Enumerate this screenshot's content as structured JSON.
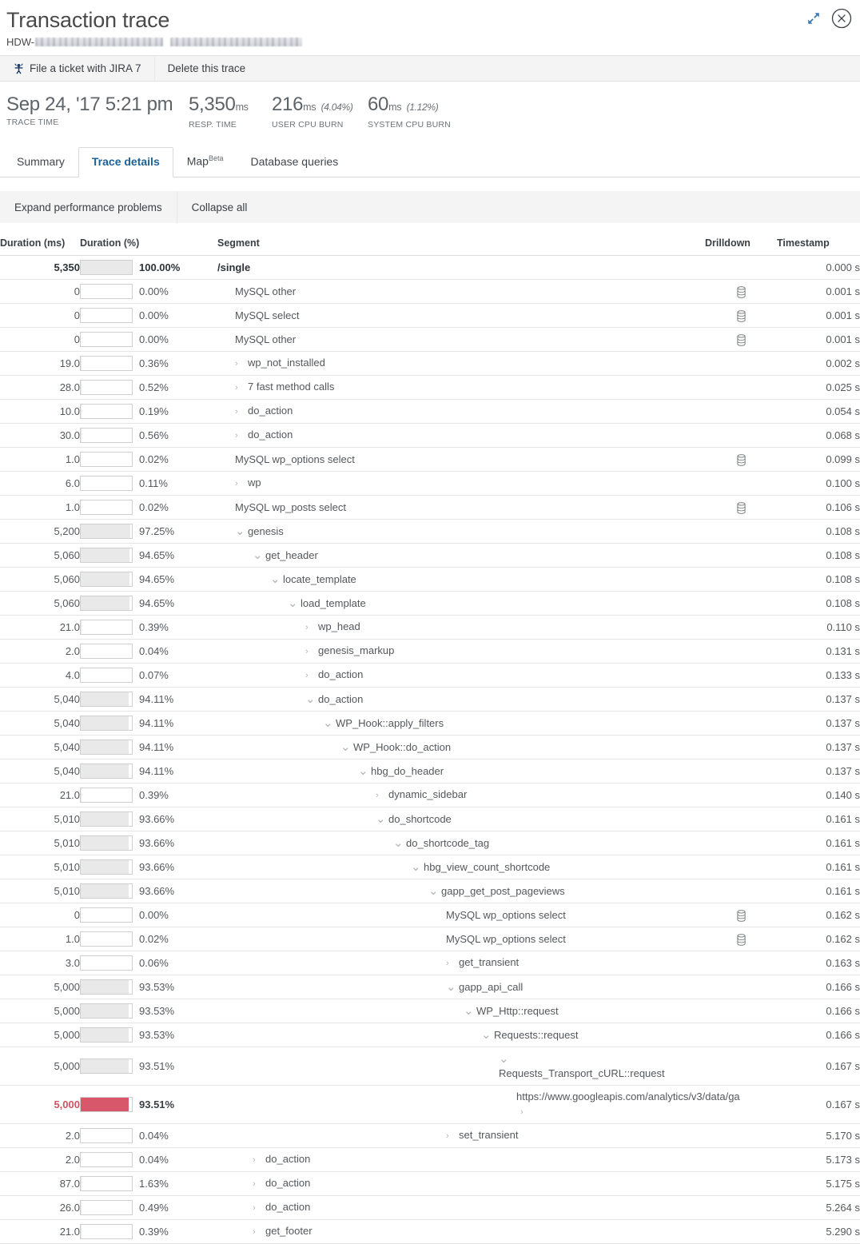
{
  "header": {
    "title": "Transaction trace",
    "subtitle_prefix": "HDW-",
    "expand_icon": "expand-icon",
    "close_icon": "close-circle-icon"
  },
  "actions": {
    "jira_icon": "jira-icon",
    "file_ticket": "File a ticket with JIRA 7",
    "delete_trace": "Delete this trace"
  },
  "metrics": [
    {
      "value": "Sep 24, '17 5:21 pm",
      "unit": "",
      "pct": "",
      "label": "TRACE TIME"
    },
    {
      "value": "5,350",
      "unit": "ms",
      "pct": "",
      "label": "RESP. TIME"
    },
    {
      "value": "216",
      "unit": "ms",
      "pct": "(4.04%)",
      "label": "USER CPU BURN"
    },
    {
      "value": "60",
      "unit": "ms",
      "pct": "(1.12%)",
      "label": "SYSTEM CPU BURN"
    }
  ],
  "tabs": [
    {
      "label": "Summary",
      "sup": "",
      "active": false
    },
    {
      "label": "Trace details",
      "sup": "",
      "active": true
    },
    {
      "label": "Map",
      "sup": "Beta",
      "active": false
    },
    {
      "label": "Database queries",
      "sup": "",
      "active": false
    }
  ],
  "subbar": [
    {
      "label": "Expand performance problems"
    },
    {
      "label": "Collapse all"
    }
  ],
  "table": {
    "columns": {
      "duration_ms": "Duration (ms)",
      "duration_pct": "Duration (%)",
      "segment": "Segment",
      "drilldown": "Drilldown",
      "timestamp": "Timestamp"
    },
    "rows": [
      {
        "duration": "5,350",
        "pct": "100.00%",
        "bar": 100,
        "level": 0,
        "chevron": "none",
        "segment": "/single",
        "drilldown": false,
        "timestamp": "0.000 s",
        "root": true
      },
      {
        "duration": "0",
        "pct": "0.00%",
        "bar": 0,
        "level": 1,
        "chevron": "none",
        "segment": "MySQL other",
        "drilldown": true,
        "timestamp": "0.001 s"
      },
      {
        "duration": "0",
        "pct": "0.00%",
        "bar": 0,
        "level": 1,
        "chevron": "none",
        "segment": "MySQL select",
        "drilldown": true,
        "timestamp": "0.001 s"
      },
      {
        "duration": "0",
        "pct": "0.00%",
        "bar": 0,
        "level": 1,
        "chevron": "none",
        "segment": "MySQL other",
        "drilldown": true,
        "timestamp": "0.001 s"
      },
      {
        "duration": "19.0",
        "pct": "0.36%",
        "bar": 0.36,
        "level": 1,
        "chevron": "right",
        "segment": "wp_not_installed",
        "drilldown": false,
        "timestamp": "0.002 s"
      },
      {
        "duration": "28.0",
        "pct": "0.52%",
        "bar": 0.52,
        "level": 1,
        "chevron": "right",
        "segment": "7 fast method calls",
        "drilldown": false,
        "timestamp": "0.025 s"
      },
      {
        "duration": "10.0",
        "pct": "0.19%",
        "bar": 0.19,
        "level": 1,
        "chevron": "right",
        "segment": "do_action",
        "drilldown": false,
        "timestamp": "0.054 s"
      },
      {
        "duration": "30.0",
        "pct": "0.56%",
        "bar": 0.56,
        "level": 1,
        "chevron": "right",
        "segment": "do_action",
        "drilldown": false,
        "timestamp": "0.068 s"
      },
      {
        "duration": "1.0",
        "pct": "0.02%",
        "bar": 0.02,
        "level": 1,
        "chevron": "none",
        "segment": "MySQL wp_options select",
        "drilldown": true,
        "timestamp": "0.099 s"
      },
      {
        "duration": "6.0",
        "pct": "0.11%",
        "bar": 0.11,
        "level": 1,
        "chevron": "right",
        "segment": "wp",
        "drilldown": false,
        "timestamp": "0.100 s"
      },
      {
        "duration": "1.0",
        "pct": "0.02%",
        "bar": 0.02,
        "level": 1,
        "chevron": "none",
        "segment": "MySQL wp_posts select",
        "drilldown": true,
        "timestamp": "0.106 s"
      },
      {
        "duration": "5,200",
        "pct": "97.25%",
        "bar": 97.25,
        "level": 1,
        "chevron": "down",
        "segment": "genesis",
        "drilldown": false,
        "timestamp": "0.108 s"
      },
      {
        "duration": "5,060",
        "pct": "94.65%",
        "bar": 94.65,
        "level": 2,
        "chevron": "down",
        "segment": "get_header",
        "drilldown": false,
        "timestamp": "0.108 s"
      },
      {
        "duration": "5,060",
        "pct": "94.65%",
        "bar": 94.65,
        "level": 3,
        "chevron": "down",
        "segment": "locate_template",
        "drilldown": false,
        "timestamp": "0.108 s"
      },
      {
        "duration": "5,060",
        "pct": "94.65%",
        "bar": 94.65,
        "level": 4,
        "chevron": "down",
        "segment": "load_template",
        "drilldown": false,
        "timestamp": "0.108 s"
      },
      {
        "duration": "21.0",
        "pct": "0.39%",
        "bar": 0.39,
        "level": 5,
        "chevron": "right",
        "segment": "wp_head",
        "drilldown": false,
        "timestamp": "0.110 s"
      },
      {
        "duration": "2.0",
        "pct": "0.04%",
        "bar": 0.04,
        "level": 5,
        "chevron": "right",
        "segment": "genesis_markup",
        "drilldown": false,
        "timestamp": "0.131 s"
      },
      {
        "duration": "4.0",
        "pct": "0.07%",
        "bar": 0.07,
        "level": 5,
        "chevron": "right",
        "segment": "do_action",
        "drilldown": false,
        "timestamp": "0.133 s"
      },
      {
        "duration": "5,040",
        "pct": "94.11%",
        "bar": 94.11,
        "level": 5,
        "chevron": "down",
        "segment": "do_action",
        "drilldown": false,
        "timestamp": "0.137 s"
      },
      {
        "duration": "5,040",
        "pct": "94.11%",
        "bar": 94.11,
        "level": 6,
        "chevron": "down",
        "segment": "WP_Hook::apply_filters",
        "drilldown": false,
        "timestamp": "0.137 s"
      },
      {
        "duration": "5,040",
        "pct": "94.11%",
        "bar": 94.11,
        "level": 7,
        "chevron": "down",
        "segment": "WP_Hook::do_action",
        "drilldown": false,
        "timestamp": "0.137 s"
      },
      {
        "duration": "5,040",
        "pct": "94.11%",
        "bar": 94.11,
        "level": 8,
        "chevron": "down",
        "segment": "hbg_do_header",
        "drilldown": false,
        "timestamp": "0.137 s"
      },
      {
        "duration": "21.0",
        "pct": "0.39%",
        "bar": 0.39,
        "level": 9,
        "chevron": "right",
        "segment": "dynamic_sidebar",
        "drilldown": false,
        "timestamp": "0.140 s"
      },
      {
        "duration": "5,010",
        "pct": "93.66%",
        "bar": 93.66,
        "level": 9,
        "chevron": "down",
        "segment": "do_shortcode",
        "drilldown": false,
        "timestamp": "0.161 s"
      },
      {
        "duration": "5,010",
        "pct": "93.66%",
        "bar": 93.66,
        "level": 10,
        "chevron": "down",
        "segment": "do_shortcode_tag",
        "drilldown": false,
        "timestamp": "0.161 s"
      },
      {
        "duration": "5,010",
        "pct": "93.66%",
        "bar": 93.66,
        "level": 11,
        "chevron": "down",
        "segment": "hbg_view_count_shortcode",
        "drilldown": false,
        "timestamp": "0.161 s"
      },
      {
        "duration": "5,010",
        "pct": "93.66%",
        "bar": 93.66,
        "level": 12,
        "chevron": "down",
        "segment": "gapp_get_post_pageviews",
        "drilldown": false,
        "timestamp": "0.161 s"
      },
      {
        "duration": "0",
        "pct": "0.00%",
        "bar": 0,
        "level": 13,
        "chevron": "none",
        "segment": "MySQL wp_options select",
        "drilldown": true,
        "timestamp": "0.162 s"
      },
      {
        "duration": "1.0",
        "pct": "0.02%",
        "bar": 0.02,
        "level": 13,
        "chevron": "none",
        "segment": "MySQL wp_options select",
        "drilldown": true,
        "timestamp": "0.162 s"
      },
      {
        "duration": "3.0",
        "pct": "0.06%",
        "bar": 0.06,
        "level": 13,
        "chevron": "right",
        "segment": "get_transient",
        "drilldown": false,
        "timestamp": "0.163 s"
      },
      {
        "duration": "5,000",
        "pct": "93.53%",
        "bar": 93.53,
        "level": 13,
        "chevron": "down",
        "segment": "gapp_api_call",
        "drilldown": false,
        "timestamp": "0.166 s"
      },
      {
        "duration": "5,000",
        "pct": "93.53%",
        "bar": 93.53,
        "level": 14,
        "chevron": "down",
        "segment": "WP_Http::request",
        "drilldown": false,
        "timestamp": "0.166 s"
      },
      {
        "duration": "5,000",
        "pct": "93.53%",
        "bar": 93.53,
        "level": 15,
        "chevron": "down",
        "segment": "Requests::request",
        "drilldown": false,
        "timestamp": "0.166 s"
      },
      {
        "duration": "5,000",
        "pct": "93.51%",
        "bar": 93.51,
        "level": 16,
        "chevron": "down",
        "segment": "Requests_Transport_cURL::request",
        "drilldown": false,
        "timestamp": "0.167 s",
        "wrap": true
      },
      {
        "duration": "5,000",
        "pct": "93.51%",
        "bar": 93.51,
        "level": 17,
        "chevron": "none",
        "trailing_chevron": true,
        "segment": "https://www.googleapis.com/analytics/v3/data/ga",
        "drilldown": false,
        "timestamp": "0.167 s",
        "alert": true,
        "wrap": true
      },
      {
        "duration": "2.0",
        "pct": "0.04%",
        "bar": 0.04,
        "level": 13,
        "chevron": "right",
        "segment": "set_transient",
        "drilldown": false,
        "timestamp": "5.170 s"
      },
      {
        "duration": "2.0",
        "pct": "0.04%",
        "bar": 0.04,
        "level": 2,
        "chevron": "right",
        "segment": "do_action",
        "drilldown": false,
        "timestamp": "5.173 s"
      },
      {
        "duration": "87.0",
        "pct": "1.63%",
        "bar": 1.63,
        "level": 2,
        "chevron": "right",
        "segment": "do_action",
        "drilldown": false,
        "timestamp": "5.175 s"
      },
      {
        "duration": "26.0",
        "pct": "0.49%",
        "bar": 0.49,
        "level": 2,
        "chevron": "right",
        "segment": "do_action",
        "drilldown": false,
        "timestamp": "5.264 s"
      },
      {
        "duration": "21.0",
        "pct": "0.39%",
        "bar": 0.39,
        "level": 2,
        "chevron": "right",
        "segment": "get_footer",
        "drilldown": false,
        "timestamp": "5.290 s"
      }
    ]
  },
  "colors": {
    "alert": "#d9576a",
    "bar_fill": "#e9e9e9",
    "accent": "#1b6298"
  }
}
